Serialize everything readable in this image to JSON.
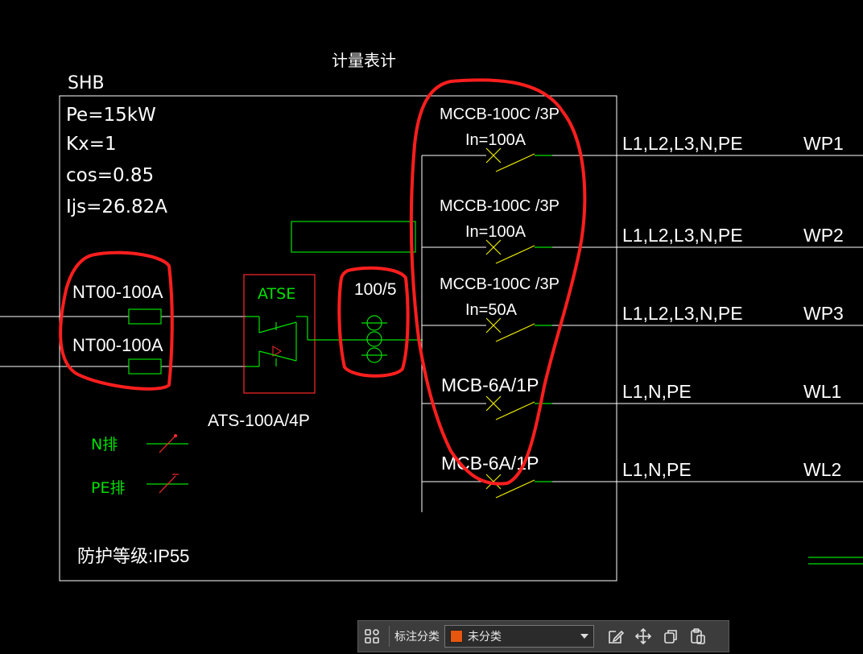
{
  "diagram": {
    "title": "计量表计",
    "panel_name": "SHB",
    "params": [
      "Pe=15kW",
      "Kx=1",
      "cos=0.85",
      "Ijs=26.82A"
    ],
    "fuses": [
      "NT00-100A",
      "NT00-100A"
    ],
    "ats": {
      "label": "ATSE",
      "model": "ATS-100A/4P"
    },
    "ct": "100/5",
    "bus_labels": [
      "N排",
      "PE排"
    ],
    "protection": "防护等级:IP55",
    "circuits": [
      {
        "breaker": "MCCB-100C /3P",
        "rating": "In=100A",
        "phases": "L1,L2,L3,N,PE",
        "id": "WP1"
      },
      {
        "breaker": "MCCB-100C /3P",
        "rating": "In=100A",
        "phases": "L1,L2,L3,N,PE",
        "id": "WP2"
      },
      {
        "breaker": "MCCB-100C /3P",
        "rating": "In=50A",
        "phases": "L1,L2,L3,N,PE",
        "id": "WP3"
      },
      {
        "breaker": "MCB-6A/1P",
        "rating": "",
        "phases": "L1,N,PE",
        "id": "WL1"
      },
      {
        "breaker": "MCB-6A/1P",
        "rating": "",
        "phases": "L1,N,PE",
        "id": "WL2"
      }
    ],
    "colors": {
      "background": "#000000",
      "line": "#ffffff",
      "accent_green": "#00e000",
      "markup_red": "#ff1e1e",
      "ats_box": "#ff2a2a",
      "switch_yellow": "#e8e800"
    }
  },
  "toolbar": {
    "grid_icon": "grid-icon",
    "label": "标注分类",
    "select_value": "未分类",
    "select_color": "#e8560f",
    "actions": [
      "edit-icon",
      "move-icon",
      "copy-icon",
      "paste-icon"
    ]
  }
}
